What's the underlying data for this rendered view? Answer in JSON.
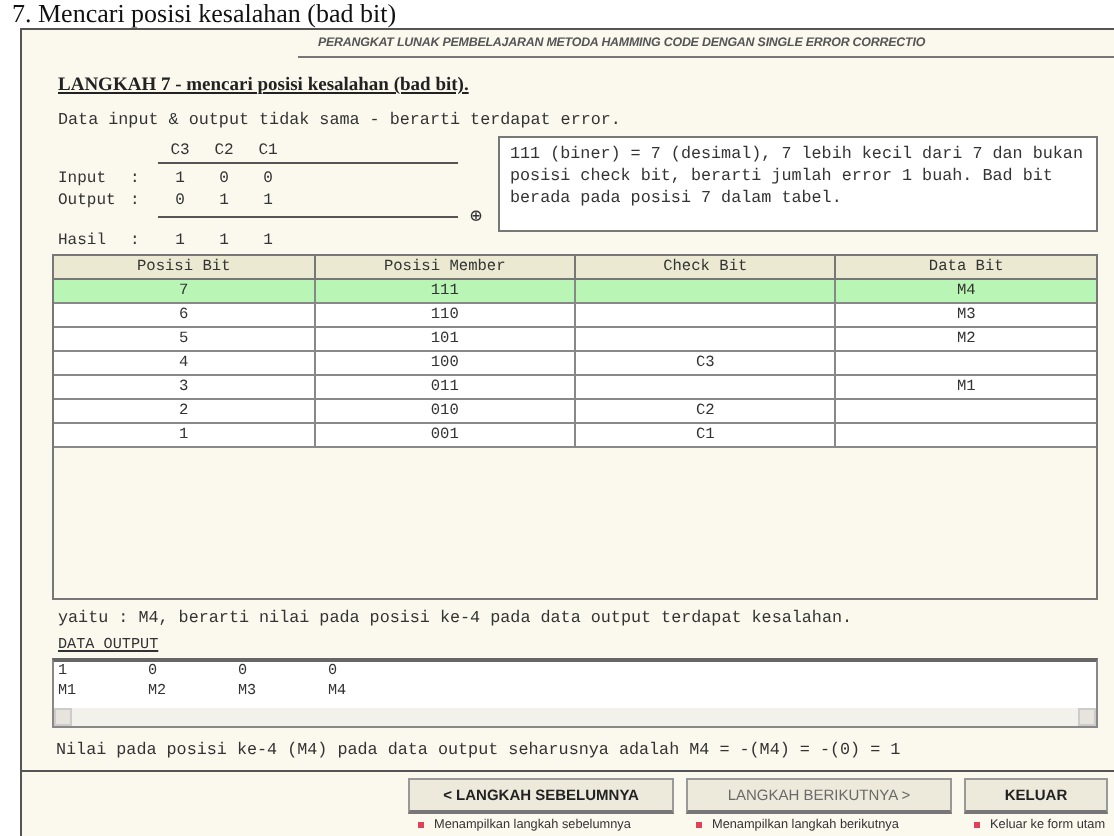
{
  "caption": "7. Mencari posisi kesalahan (bad bit)",
  "header": "PERANGKAT LUNAK PEMBELAJARAN METODA HAMMING CODE DENGAN SINGLE ERROR CORRECTIO",
  "step_title": "LANGKAH 7 - mencari posisi kesalahan (bad bit).",
  "intro": "Data input & output tidak sama - berarti terdapat error.",
  "xor": {
    "columns": [
      "C3",
      "C2",
      "C1"
    ],
    "rows": [
      {
        "label": "Input",
        "sep": ":",
        "values": [
          "1",
          "0",
          "0"
        ]
      },
      {
        "label": "Output",
        "sep": ":",
        "values": [
          "0",
          "1",
          "1"
        ]
      }
    ],
    "operator": "⊕",
    "result": {
      "label": "Hasil",
      "sep": ":",
      "values": [
        "1",
        "1",
        "1"
      ]
    }
  },
  "explanation": "111 (biner) = 7 (desimal), 7 lebih kecil dari 7 dan bukan posisi check bit, berarti jumlah error 1 buah. Bad bit berada pada posisi 7 dalam tabel.",
  "table": {
    "columns": [
      "Posisi Bit",
      "Posisi Member",
      "Check Bit",
      "Data Bit"
    ],
    "rows": [
      {
        "cells": [
          "7",
          "111",
          "",
          "M4"
        ],
        "selected": true
      },
      {
        "cells": [
          "6",
          "110",
          "",
          "M3"
        ],
        "selected": false
      },
      {
        "cells": [
          "5",
          "101",
          "",
          "M2"
        ],
        "selected": false
      },
      {
        "cells": [
          "4",
          "100",
          "C3",
          ""
        ],
        "selected": false
      },
      {
        "cells": [
          "3",
          "011",
          "",
          "M1"
        ],
        "selected": false
      },
      {
        "cells": [
          "2",
          "010",
          "C2",
          ""
        ],
        "selected": false
      },
      {
        "cells": [
          "1",
          "001",
          "C1",
          ""
        ],
        "selected": false
      }
    ]
  },
  "conclusion": "yaitu : M4, berarti nilai pada posisi ke-4 pada data output terdapat kesalahan.",
  "data_output": {
    "label": "DATA OUTPUT",
    "rows": [
      [
        "1",
        "0",
        "0",
        "0"
      ],
      [
        "M1",
        "M2",
        "M3",
        "M4"
      ]
    ]
  },
  "result_line": "Nilai pada posisi ke-4 (M4) pada data output seharusnya adalah M4 = -(M4) = -(0) = 1",
  "buttons": [
    {
      "label": "< LANGKAH SEBELUMNYA",
      "disabled": false,
      "hint": "Menampilkan langkah sebelumnya"
    },
    {
      "label": "LANGKAH BERIKUTNYA >",
      "disabled": true,
      "hint": "Menampilkan langkah berikutnya"
    },
    {
      "label": "KELUAR",
      "disabled": false,
      "hint": "Keluar ke form utam"
    }
  ]
}
